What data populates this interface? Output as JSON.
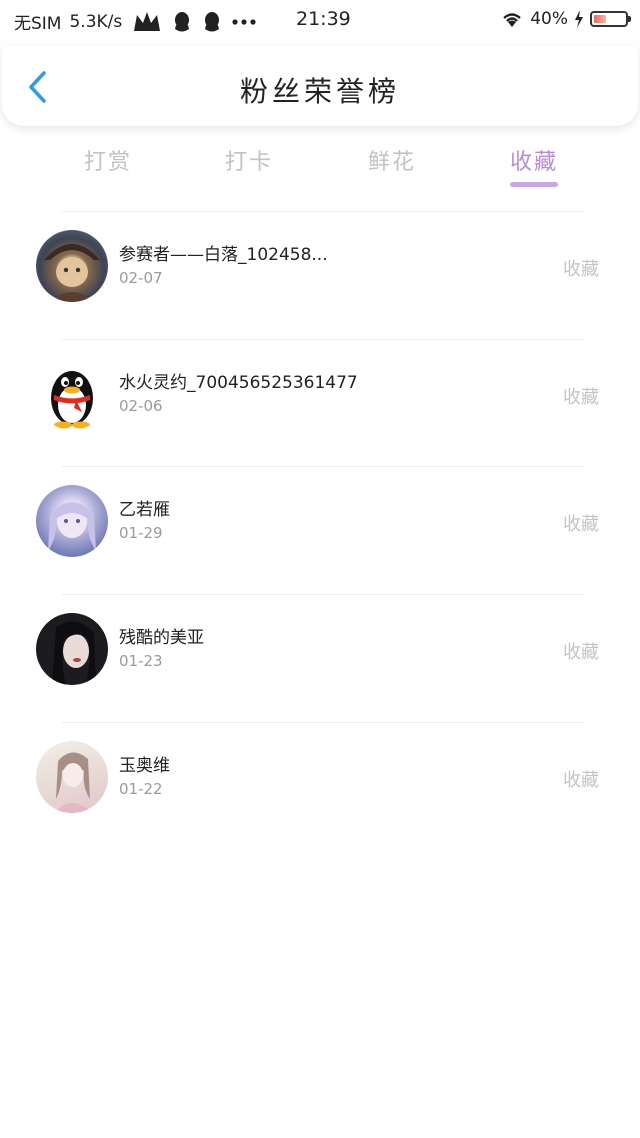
{
  "status_bar": {
    "carrier": "无SIM",
    "speed": "5.3K/s",
    "time": "21:39",
    "battery_percent": "40%",
    "battery_level": 0.4
  },
  "header": {
    "title": "粉丝荣誉榜"
  },
  "tabs": [
    {
      "label": "打赏",
      "active": false
    },
    {
      "label": "打卡",
      "active": false
    },
    {
      "label": "鲜花",
      "active": false
    },
    {
      "label": "收藏",
      "active": true
    }
  ],
  "list": [
    {
      "name": "参赛者——白落_102458...",
      "date": "02-07",
      "action": "收藏"
    },
    {
      "name": "水火灵约_700456525361477",
      "date": "02-06",
      "action": "收藏"
    },
    {
      "name": "乙若雁",
      "date": "01-29",
      "action": "收藏"
    },
    {
      "name": "残酷的美亚",
      "date": "01-23",
      "action": "收藏"
    },
    {
      "name": "玉奥维",
      "date": "01-22",
      "action": "收藏"
    }
  ],
  "colors": {
    "accent": "#b58ce0",
    "back_arrow": "#2f9be8",
    "inactive_tab": "#c2c2c2"
  }
}
